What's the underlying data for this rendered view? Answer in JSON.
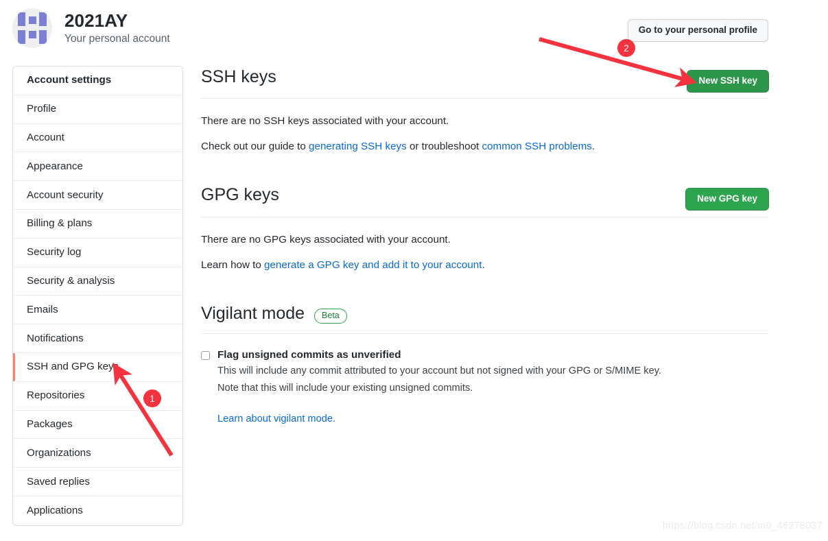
{
  "account": {
    "name": "2021AY",
    "subtitle": "Your personal account",
    "avatar_icon": "identicon-avatar",
    "avatar_bg": "#efeff1",
    "avatar_fg": "#7b80d6"
  },
  "header": {
    "profile_button": "Go to your personal profile"
  },
  "sidebar": {
    "items": [
      {
        "label": "Account settings",
        "active": false,
        "heading": true
      },
      {
        "label": "Profile",
        "active": false,
        "heading": false
      },
      {
        "label": "Account",
        "active": false,
        "heading": false
      },
      {
        "label": "Appearance",
        "active": false,
        "heading": false
      },
      {
        "label": "Account security",
        "active": false,
        "heading": false
      },
      {
        "label": "Billing & plans",
        "active": false,
        "heading": false
      },
      {
        "label": "Security log",
        "active": false,
        "heading": false
      },
      {
        "label": "Security & analysis",
        "active": false,
        "heading": false
      },
      {
        "label": "Emails",
        "active": false,
        "heading": false
      },
      {
        "label": "Notifications",
        "active": false,
        "heading": false
      },
      {
        "label": "SSH and GPG keys",
        "active": true,
        "heading": false
      },
      {
        "label": "Repositories",
        "active": false,
        "heading": false
      },
      {
        "label": "Packages",
        "active": false,
        "heading": false
      },
      {
        "label": "Organizations",
        "active": false,
        "heading": false
      },
      {
        "label": "Saved replies",
        "active": false,
        "heading": false
      },
      {
        "label": "Applications",
        "active": false,
        "heading": false
      }
    ],
    "active_border_color": "#f78166"
  },
  "ssh_section": {
    "title": "SSH keys",
    "new_button": "New SSH key",
    "empty_text": "There are no SSH keys associated with your account.",
    "guide_prefix": "Check out our guide to ",
    "guide_link_1": "generating SSH keys",
    "guide_middle": " or troubleshoot ",
    "guide_link_2": "common SSH problems",
    "guide_suffix": "."
  },
  "gpg_section": {
    "title": "GPG keys",
    "new_button": "New GPG key",
    "empty_text": "There are no GPG keys associated with your account.",
    "learn_prefix": "Learn how to ",
    "learn_link": "generate a GPG key and add it to your account",
    "learn_suffix": "."
  },
  "vigilant_section": {
    "title": "Vigilant mode",
    "badge": "Beta",
    "checkbox_label": "Flag unsigned commits as unverified",
    "checkbox_checked": false,
    "description_line_1": "This will include any commit attributed to your account but not signed with your GPG or S/MIME key.",
    "description_line_2": "Note that this will include your existing unsigned commits.",
    "learn_link": "Learn about vigilant mode."
  },
  "annotations": {
    "marker_1": "1",
    "marker_2": "2",
    "arrow_color": "#f5333f"
  },
  "watermark": "https://blog.csdn.net/m0_46278037",
  "colors": {
    "green_primary": "#2c974b",
    "green_bright": "#2da44e",
    "link_blue": "#0969da",
    "annotation_red": "#f5333f",
    "active_orange": "#f78166"
  }
}
